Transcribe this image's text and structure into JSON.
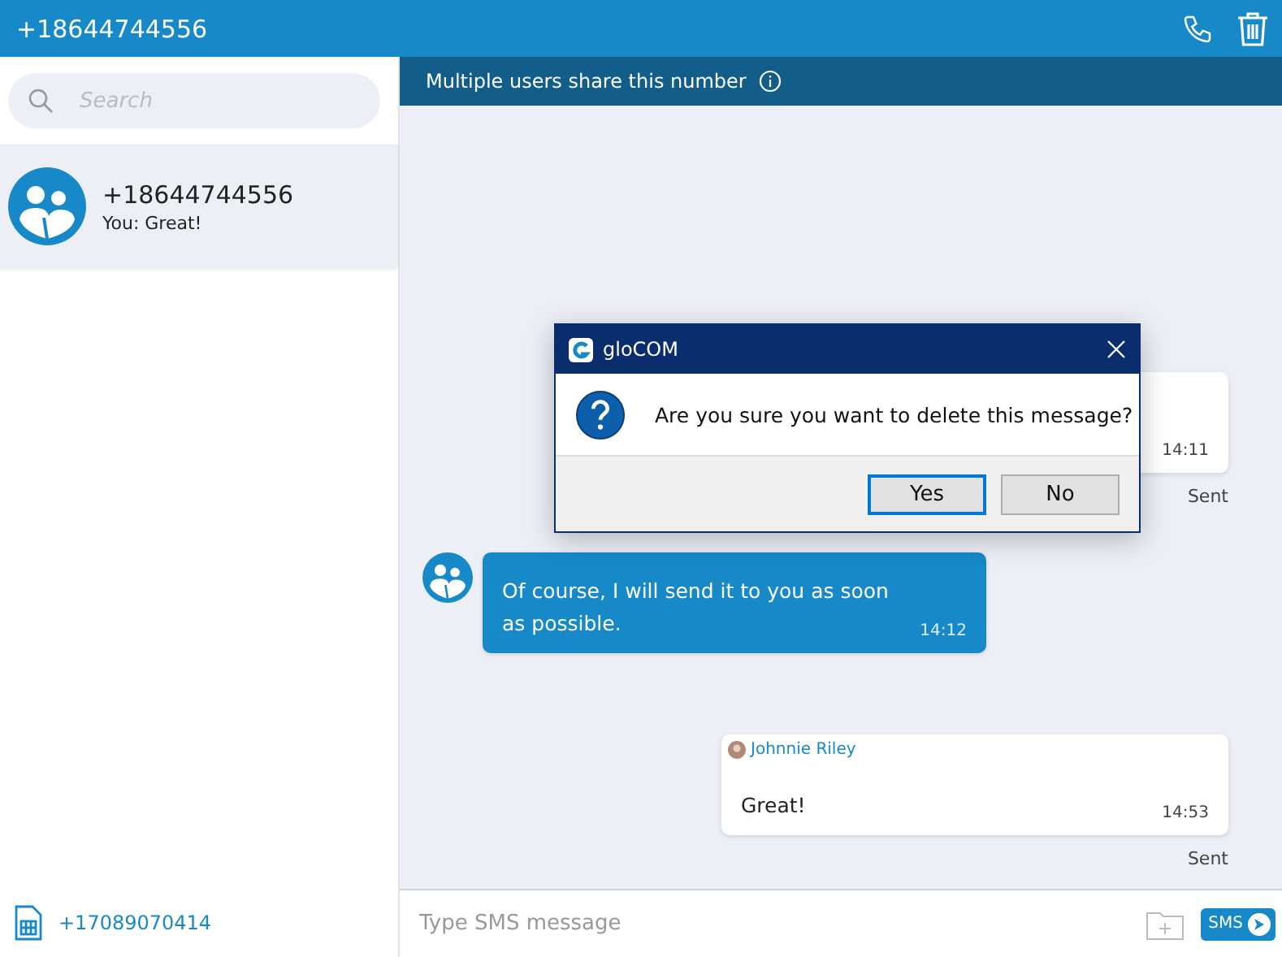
{
  "header": {
    "title": "+18644744556"
  },
  "search": {
    "placeholder": "Search"
  },
  "conversations": [
    {
      "name": "+18644744556",
      "preview": "You: Great!",
      "selected": true
    }
  ],
  "sidebar_footer": {
    "number": "+17089070414"
  },
  "banner": {
    "text": "Multiple users share this number"
  },
  "messages": [
    {
      "kind": "outgoing",
      "time": "14:11",
      "status": "Sent"
    },
    {
      "kind": "incoming",
      "text": "Of course, I will send it to you as soon as possible.",
      "time": "14:12"
    },
    {
      "kind": "outgoing",
      "sender": "Johnnie Riley",
      "text": "Great!",
      "time": "14:53",
      "status": "Sent"
    }
  ],
  "compose": {
    "placeholder": "Type SMS message",
    "send_label": "SMS"
  },
  "dialog": {
    "title": "gloCOM",
    "message": "Are you sure you want to delete this message?",
    "buttons": [
      {
        "label": "Yes",
        "selected": true
      },
      {
        "label": "No",
        "selected": false
      }
    ]
  }
}
